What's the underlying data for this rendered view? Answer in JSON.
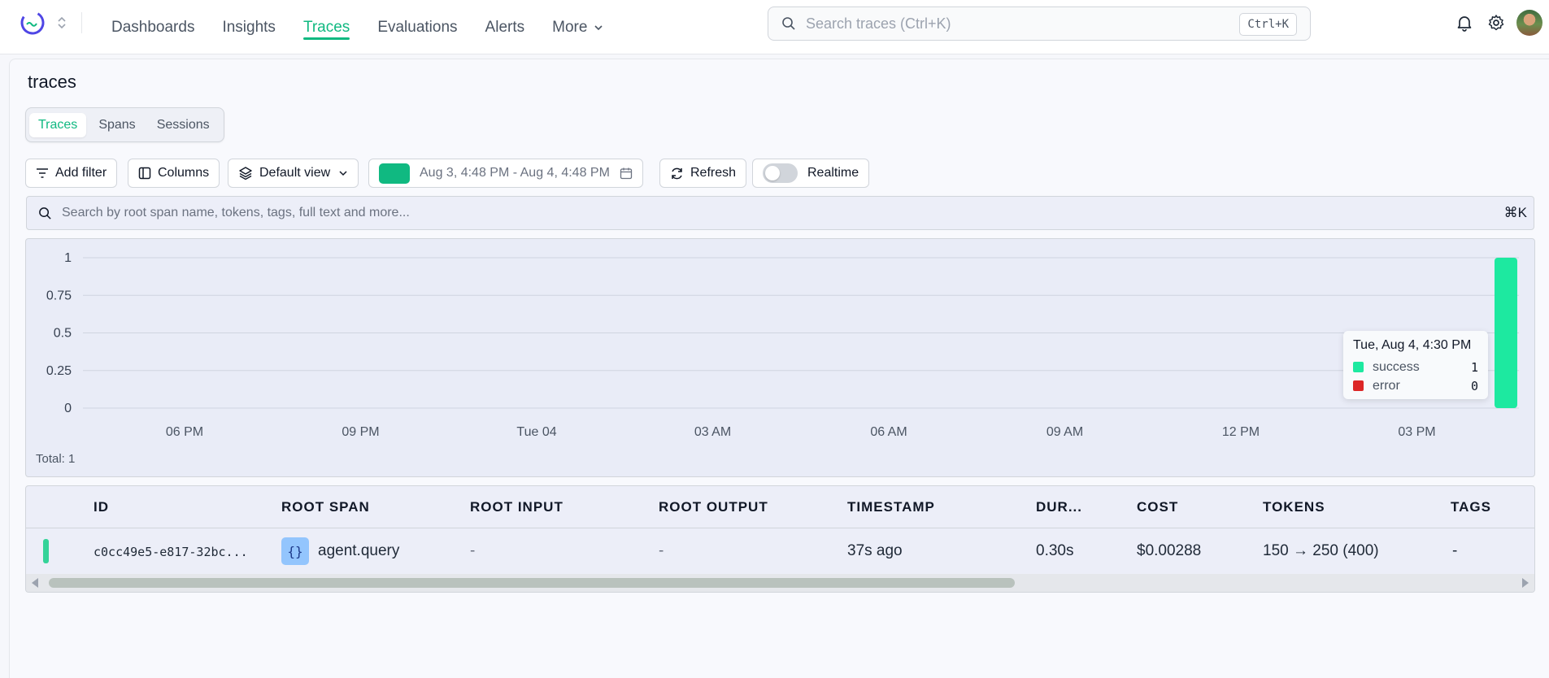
{
  "nav": {
    "items": [
      {
        "label": "Dashboards",
        "active": false
      },
      {
        "label": "Insights",
        "active": false
      },
      {
        "label": "Traces",
        "active": true
      },
      {
        "label": "Evaluations",
        "active": false
      },
      {
        "label": "Alerts",
        "active": false
      },
      {
        "label": "More",
        "active": false,
        "dropdown": true
      }
    ],
    "search_placeholder": "Search traces (Ctrl+K)",
    "search_shortcut": "Ctrl+K"
  },
  "page": {
    "title": "traces",
    "tabs": [
      {
        "label": "Traces",
        "active": true
      },
      {
        "label": "Spans",
        "active": false
      },
      {
        "label": "Sessions",
        "active": false
      }
    ]
  },
  "toolbar": {
    "add_filter": "Add filter",
    "columns": "Columns",
    "default_view": "Default view",
    "date_range": "Aug 3, 4:48 PM - Aug 4, 4:48 PM",
    "refresh": "Refresh",
    "realtime": "Realtime",
    "realtime_on": false
  },
  "trace_search": {
    "placeholder": "Search by root span name, tokens, tags, full text and more...",
    "shortcut": "⌘K"
  },
  "colors": {
    "accent": "#10b981",
    "success": "#1de9a0",
    "error": "#dc2626"
  },
  "chart_data": {
    "type": "bar",
    "y_ticks": [
      "1",
      "0.75",
      "0.5",
      "0.25",
      "0"
    ],
    "ylim": [
      0,
      1
    ],
    "x_ticks": [
      "06 PM",
      "09 PM",
      "Tue 04",
      "03 AM",
      "06 AM",
      "09 AM",
      "12 PM",
      "03 PM"
    ],
    "series": [
      {
        "name": "success",
        "color": "#1de9a0",
        "points": [
          {
            "x": "Aug 4, 4:30 PM",
            "value": 1
          }
        ]
      },
      {
        "name": "error",
        "color": "#dc2626",
        "points": [
          {
            "x": "Aug 4, 4:30 PM",
            "value": 0
          }
        ]
      }
    ],
    "total_label": "Total: 1",
    "grid": true
  },
  "tooltip": {
    "title": "Tue, Aug 4, 4:30 PM",
    "rows": [
      {
        "label": "success",
        "value": "1"
      },
      {
        "label": "error",
        "value": "0"
      }
    ]
  },
  "table": {
    "headers": {
      "id": "ID",
      "root_span": "ROOT SPAN",
      "root_input": "ROOT INPUT",
      "root_output": "ROOT OUTPUT",
      "timestamp": "TIMESTAMP",
      "duration": "DUR...",
      "cost": "COST",
      "tokens": "TOKENS",
      "tags": "TAGS"
    },
    "rows": [
      {
        "id": "c0cc49e5-e817-32bc...",
        "root_span_icon": "{}",
        "root_span": "agent.query",
        "root_input": "-",
        "root_output": "-",
        "timestamp": "37s ago",
        "duration": "0.30s",
        "cost": "$0.00288",
        "tokens": "150 → 250 (400)",
        "tags": "-"
      }
    ]
  }
}
